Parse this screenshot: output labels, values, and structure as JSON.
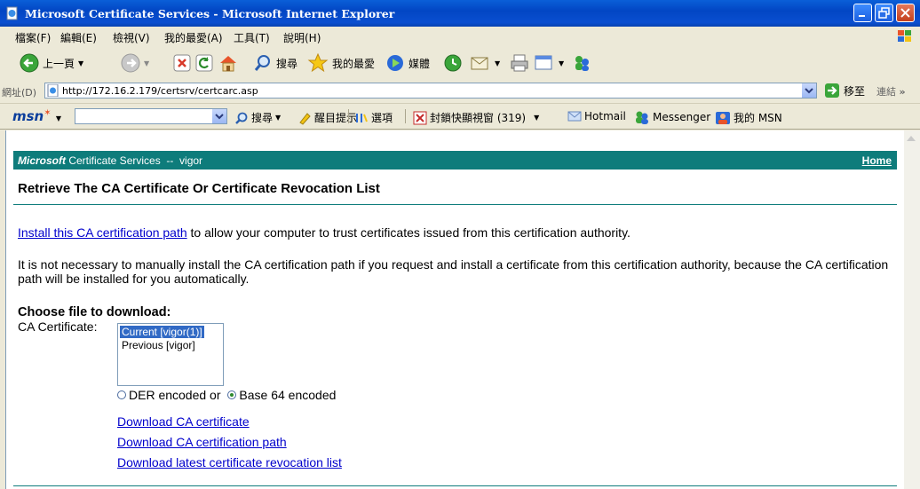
{
  "window": {
    "title": "Microsoft Certificate Services - Microsoft Internet Explorer"
  },
  "menu": [
    "檔案(F)",
    "編輯(E)",
    "檢視(V)",
    "我的最愛(A)",
    "工具(T)",
    "說明(H)"
  ],
  "toolbar": {
    "back_label": "上一頁",
    "search_label": "搜尋",
    "favorites_label": "我的最愛",
    "media_label": "媒體"
  },
  "address": {
    "label": "網址(D)",
    "url": "http://172.16.2.179/certsrv/certcarc.asp",
    "go_label": "移至",
    "links_label": "連結"
  },
  "msn": {
    "logo": "msn",
    "search_label": "搜尋",
    "highlight_label": "醒目提示",
    "options_label": "選項",
    "popup_label": "封鎖快顯視窗 (319)",
    "hotmail_label": "Hotmail",
    "messenger_label": "Messenger",
    "mymsn_label": "我的 MSN"
  },
  "page": {
    "banner_brand": "Microsoft",
    "banner_rest": " Certificate Services  --  vigor",
    "home_link": "Home",
    "heading": "Retrieve The CA Certificate Or Certificate Revocation List",
    "install_link": "Install this CA certification path",
    "install_rest": " to allow your computer to trust certificates issued from this certification authority.",
    "note": "It is not necessary to manually install the CA certification path if you request and install a certificate from this certification authority, because the CA certification path will be installed for you automatically.",
    "choose_heading": "Choose file to download:",
    "ca_label": "CA Certificate:",
    "ca_options": [
      "Current [vigor(1)]",
      "Previous [vigor]"
    ],
    "encoding": {
      "der": "DER encoded",
      "or": " or ",
      "base64": "Base 64 encoded",
      "selected": "base64"
    },
    "download_links": [
      "Download CA certificate",
      "Download CA certification path",
      "Download latest certificate revocation list"
    ]
  }
}
